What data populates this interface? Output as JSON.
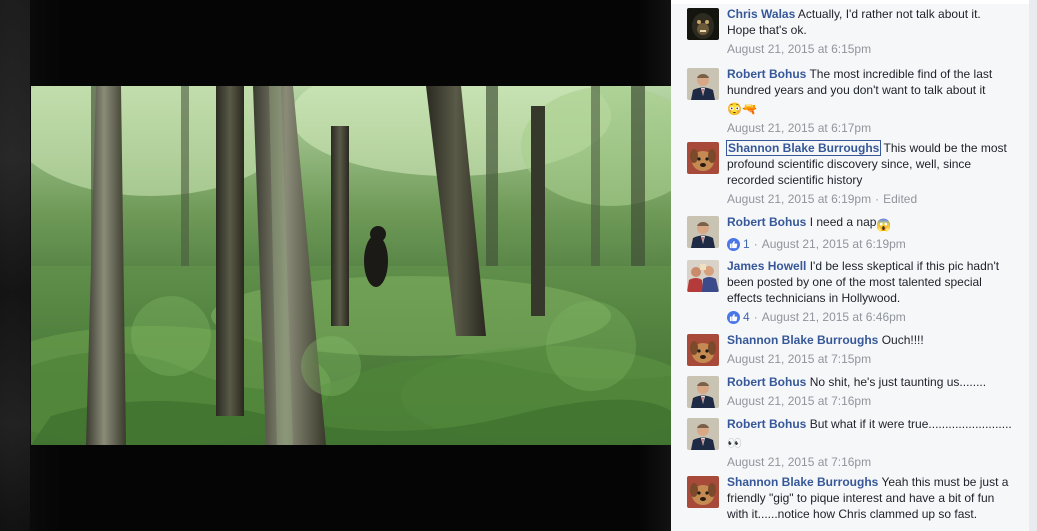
{
  "photo": {
    "alt": ""
  },
  "comments": [
    {
      "author": "Chris Walas",
      "text": "Actually, I'd rather not talk about it. Hope that's ok.",
      "time": "August 21, 2015 at 6:15pm",
      "avatar": "gorilla-avatar"
    },
    {
      "author": "Robert Bohus",
      "text": "The most incredible find of the last hundred years and you don't want to talk about it",
      "emojis": "😳🔫",
      "time": "August 21, 2015 at 6:17pm",
      "avatar": "man-suit-avatar"
    },
    {
      "author": "Shannon Blake Burroughs",
      "text": "This would be the most profound scientific discovery since, well, since recorded scientific history",
      "time": "August 21, 2015 at 6:19pm",
      "edited": "Edited",
      "avatar": "dog-avatar"
    },
    {
      "author": "Robert Bohus",
      "text": "I need a nap",
      "emojis": "😱",
      "likes": "1",
      "time": "August 21, 2015 at 6:19pm",
      "avatar": "man-suit-avatar"
    },
    {
      "author": "James Howell",
      "text": "I'd be less skeptical if this pic hadn't been posted by one of the most talented special effects technicians in Hollywood.",
      "likes": "4",
      "time": "August 21, 2015 at 6:46pm",
      "avatar": "group-avatar"
    },
    {
      "author": "Shannon Blake Burroughs",
      "text": "Ouch!!!!",
      "time": "August 21, 2015 at 7:15pm",
      "avatar": "dog-avatar"
    },
    {
      "author": "Robert Bohus",
      "text": "No shit, he's just taunting us........",
      "time": "August 21, 2015 at 7:16pm",
      "avatar": "man-suit-avatar"
    },
    {
      "author": "Robert Bohus",
      "text": "But what if it were true.........................",
      "emojis": "👀",
      "time": "August 21, 2015 at 7:16pm",
      "avatar": "man-suit-avatar"
    },
    {
      "author": "Shannon Blake Burroughs",
      "text": "Yeah this must be just a friendly \"gig\" to pique interest and have a bit of fun with it......notice how Chris clammed up so fast.",
      "time": "",
      "avatar": "dog-avatar"
    }
  ],
  "colors": {
    "link": "#365899",
    "meta": "#90949c",
    "panel": "#f6f7f9",
    "like": "#4a76e8"
  }
}
